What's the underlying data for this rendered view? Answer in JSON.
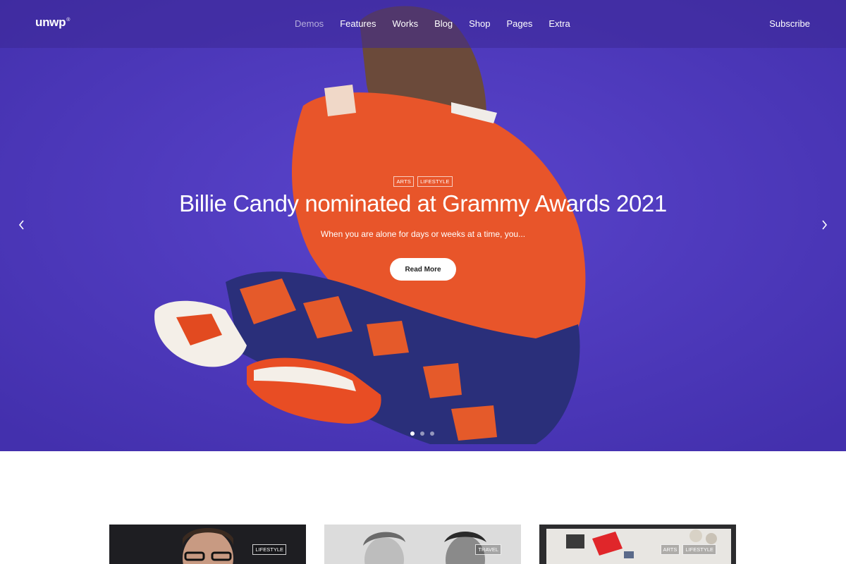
{
  "header": {
    "logo": "unwp",
    "logo_mark": "®",
    "nav": [
      {
        "label": "Demos",
        "active": true
      },
      {
        "label": "Features",
        "active": false
      },
      {
        "label": "Works",
        "active": false
      },
      {
        "label": "Blog",
        "active": false
      },
      {
        "label": "Shop",
        "active": false
      },
      {
        "label": "Pages",
        "active": false
      },
      {
        "label": "Extra",
        "active": false
      }
    ],
    "subscribe": "Subscribe"
  },
  "hero": {
    "tags": [
      "ARTS",
      "LIFESTYLE"
    ],
    "title": "Billie Candy nominated at Grammy Awards 2021",
    "excerpt": "When you are alone for days or weeks at a time, you...",
    "button": "Read More",
    "slide_count": 3,
    "active_slide": 1,
    "icons": {
      "prev": "chevron-left-icon",
      "next": "chevron-right-icon"
    },
    "colors": {
      "background": "#4f3bbd",
      "accent": "#ff4f24"
    }
  },
  "posts": [
    {
      "tags": [
        "LIFESTYLE"
      ]
    },
    {
      "tags": [
        "TRAVEL"
      ]
    },
    {
      "tags": [
        "ARTS",
        "LIFESTYLE"
      ]
    }
  ]
}
